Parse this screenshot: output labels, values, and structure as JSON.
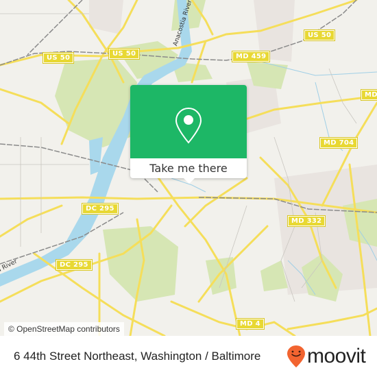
{
  "map": {
    "attribution": "© OpenStreetMap contributors",
    "colors": {
      "land": "#f2f1ec",
      "park": "#d9e8b8",
      "water": "#a9d8ec",
      "road": "#f5e06a",
      "rail": "#8a8a8a",
      "urban": "#e8e2df"
    },
    "shields": [
      {
        "label": "US 50"
      },
      {
        "label": "US 50"
      },
      {
        "label": "US 50"
      },
      {
        "label": "MD 459"
      },
      {
        "label": "MD 704"
      },
      {
        "label": "MD"
      },
      {
        "label": "DC 295"
      },
      {
        "label": "DC 295"
      },
      {
        "label": "MD 332"
      },
      {
        "label": "MD 4"
      }
    ],
    "rivers": [
      {
        "label": "Anacostia River"
      },
      {
        "label": "Anacostia River"
      }
    ]
  },
  "popup": {
    "action_label": "Take me there",
    "accent_color": "#1db766"
  },
  "footer": {
    "address": "6 44th Street Northeast, Washington / Baltimore",
    "brand": "moovit",
    "brand_color": "#f26430"
  }
}
